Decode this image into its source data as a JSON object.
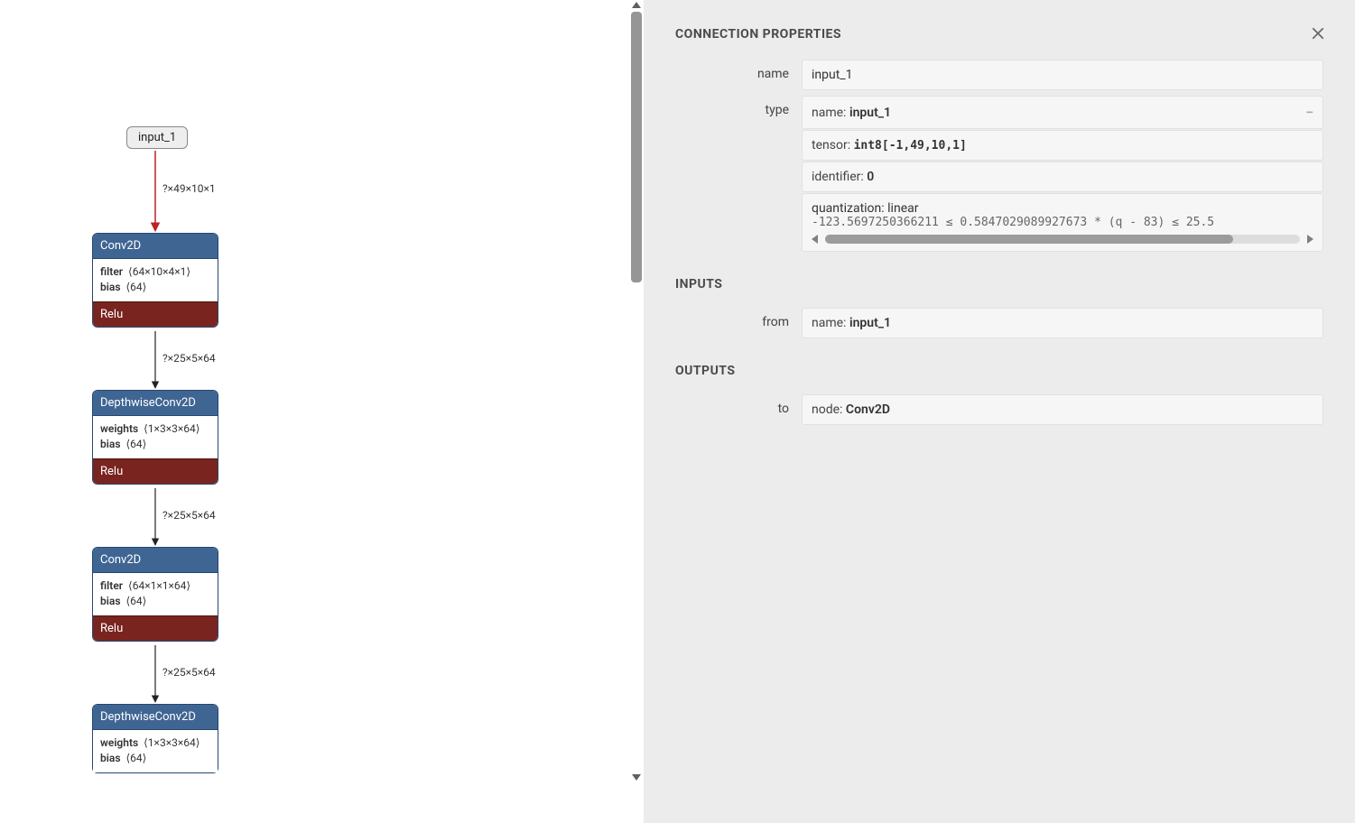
{
  "panel": {
    "title": "CONNECTION PROPERTIES",
    "name_label": "name",
    "name_value": "input_1",
    "type_label": "type",
    "type_name_key": "name:",
    "type_name_value": "input_1",
    "tensor_key": "tensor:",
    "tensor_value": "int8[-1,49,10,1]",
    "identifier_key": "identifier:",
    "identifier_value": "0",
    "quant_key": "quantization:",
    "quant_value": "linear",
    "quant_formula": "-123.5697250366211 ≤ 0.5847029089927673 * (q - 83) ≤ 25.5",
    "inputs_title": "INPUTS",
    "from_label": "from",
    "from_key": "name:",
    "from_value": "input_1",
    "outputs_title": "OUTPUTS",
    "to_label": "to",
    "to_key": "node:",
    "to_value": "Conv2D"
  },
  "graph": {
    "input_label": "input_1",
    "edge1": "?×49×10×1",
    "n1_title": "Conv2D",
    "n1_filter_k": "filter",
    "n1_filter_v": "⟨64×10×4×1⟩",
    "n1_bias_k": "bias",
    "n1_bias_v": "⟨64⟩",
    "n1_act": "Relu",
    "edge2": "?×25×5×64",
    "n2_title": "DepthwiseConv2D",
    "n2_w_k": "weights",
    "n2_w_v": "⟨1×3×3×64⟩",
    "n2_bias_k": "bias",
    "n2_bias_v": "⟨64⟩",
    "n2_act": "Relu",
    "edge3": "?×25×5×64",
    "n3_title": "Conv2D",
    "n3_filter_k": "filter",
    "n3_filter_v": "⟨64×1×1×64⟩",
    "n3_bias_k": "bias",
    "n3_bias_v": "⟨64⟩",
    "n3_act": "Relu",
    "edge4": "?×25×5×64",
    "n4_title": "DepthwiseConv2D",
    "n4_w_k": "weights",
    "n4_w_v": "⟨1×3×3×64⟩",
    "n4_bias_k": "bias",
    "n4_bias_v": "⟨64⟩"
  }
}
